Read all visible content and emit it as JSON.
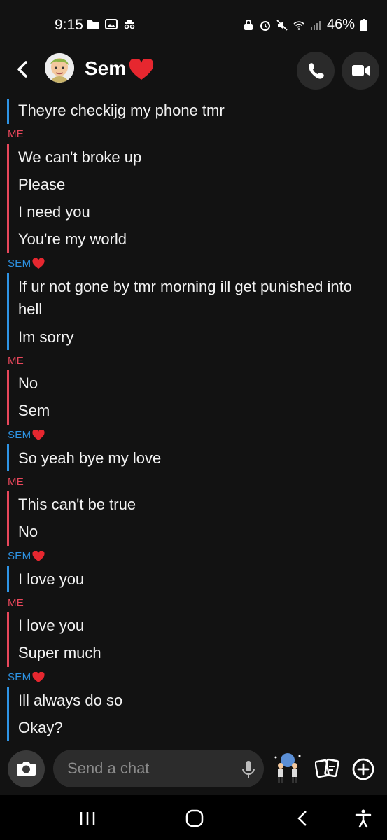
{
  "status_bar": {
    "time": "9:15",
    "battery": "46%"
  },
  "header": {
    "contact_name": "Sem",
    "icons": [
      "back-chevron-icon",
      "avatar",
      "heart-icon",
      "phone-icon",
      "video-camera-icon"
    ]
  },
  "messages": [
    {
      "sender": "sem",
      "text": "Theyre checkijg my phone tmr"
    },
    {
      "sender_label": "ME",
      "sender": "me",
      "text": "We can't broke up"
    },
    {
      "sender": "me",
      "text": "Please"
    },
    {
      "sender": "me",
      "text": "I need you"
    },
    {
      "sender": "me",
      "text": "You're my world"
    },
    {
      "sender_label": "SEM",
      "sender": "sem",
      "text": "If ur not gone by tmr morning ill get punished into hell"
    },
    {
      "sender": "sem",
      "text": "Im sorry"
    },
    {
      "sender_label": "ME",
      "sender": "me",
      "text": "No"
    },
    {
      "sender": "me",
      "text": "Sem"
    },
    {
      "sender_label": "SEM",
      "sender": "sem",
      "text": "So yeah bye my love"
    },
    {
      "sender_label": "ME",
      "sender": "me",
      "text": "This can't be true"
    },
    {
      "sender": "me",
      "text": "No"
    },
    {
      "sender_label": "SEM",
      "sender": "sem",
      "text": "I love you"
    },
    {
      "sender_label": "ME",
      "sender": "me",
      "text": "I love you"
    },
    {
      "sender": "me",
      "text": "Super much"
    },
    {
      "sender_label": "SEM",
      "sender": "sem",
      "text": "Ill always do so"
    },
    {
      "sender": "sem",
      "text": "Okay?"
    }
  ],
  "composer": {
    "placeholder": "Send a chat"
  },
  "colors": {
    "me": "#e8475b",
    "sem": "#2e94e5",
    "background": "#121212"
  }
}
